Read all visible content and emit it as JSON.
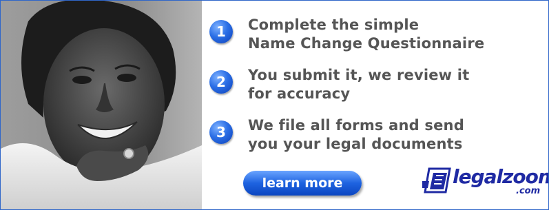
{
  "steps": [
    {
      "number": "1",
      "lines": [
        "Complete the simple",
        "Name Change Questionnaire"
      ]
    },
    {
      "number": "2",
      "lines": [
        "You submit it, we review it",
        "for accuracy"
      ]
    },
    {
      "number": "3",
      "lines": [
        "We file all forms and send",
        "you your legal documents"
      ]
    }
  ],
  "cta": {
    "label": "learn more"
  },
  "logo": {
    "word": "legalzoom",
    "sub": ".com"
  },
  "colors": {
    "border": "#2f66c9",
    "step_badge": "#2b6fe6",
    "step_text": "#555555",
    "button": "#1e63e0",
    "logo": "#1f2aa3"
  },
  "icons": {
    "photo": "smiling-woman-photo",
    "logo_mark": "legalzoom-logo-icon"
  }
}
